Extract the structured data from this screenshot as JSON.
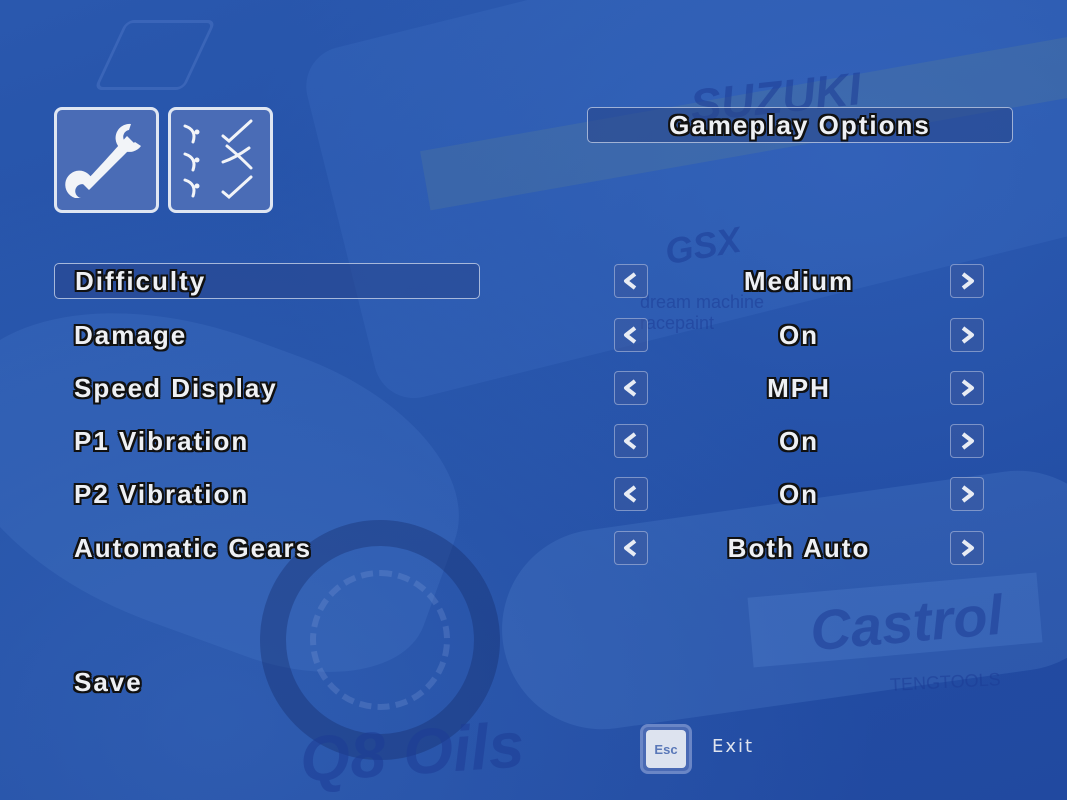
{
  "screen": {
    "title": "Gameplay Options",
    "tabs": [
      {
        "name": "settings",
        "icon": "wrench-icon"
      },
      {
        "name": "gameplay",
        "icon": "checklist-icon"
      }
    ],
    "options": [
      {
        "label": "Difficulty",
        "value": "Medium",
        "selected": true
      },
      {
        "label": "Damage",
        "value": "On",
        "selected": false
      },
      {
        "label": "Speed Display",
        "value": "MPH",
        "selected": false
      },
      {
        "label": "P1 Vibration",
        "value": "On",
        "selected": false
      },
      {
        "label": "P2 Vibration",
        "value": "On",
        "selected": false
      },
      {
        "label": "Automatic Gears",
        "value": "Both Auto",
        "selected": false
      }
    ],
    "save_label": "Save",
    "footer": {
      "key_label": "Esc",
      "action_label": "Exit"
    },
    "arrows": {
      "left": "left-arrow-icon",
      "right": "right-arrow-icon"
    }
  },
  "background_watermarks": [
    "SUZUKI",
    "GSX",
    "Castrol",
    "Q8 Oils",
    "TENGTOOLS",
    "dream machine racepaint"
  ],
  "colors": {
    "background": "#2452a8",
    "panel_border": "#dfe6f2",
    "text": "#eef0f4",
    "text_outline": "#111111"
  }
}
